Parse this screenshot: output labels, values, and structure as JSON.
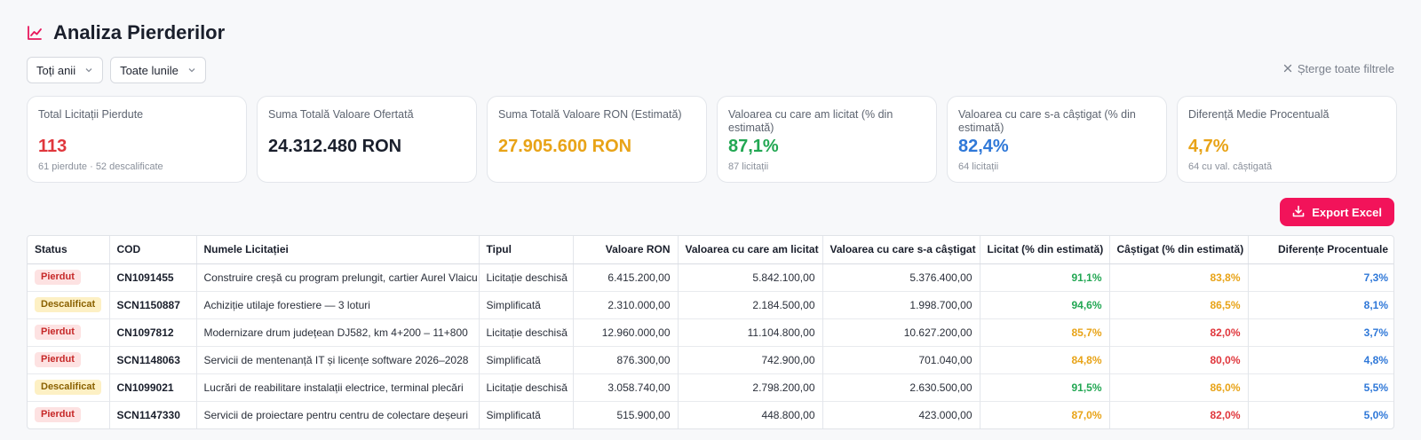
{
  "header": {
    "title": "Analiza Pierderilor",
    "icon": "line-chart-icon",
    "accent": "#e8175d"
  },
  "filters": {
    "year": "Toți anii",
    "month": "Toate lunile",
    "clear_label": "Șterge toate filtrele"
  },
  "cards": [
    {
      "label": "Total Licitații Pierdute",
      "value": "113",
      "sub": "61 pierdute · 52 descalificate",
      "color": "#e0363c"
    },
    {
      "label": "Suma Totală Valoare Ofertată",
      "value": "24.312.480 RON",
      "sub": "",
      "color": "#1a1f2c"
    },
    {
      "label": "Suma Totală Valoare RON (Estimată)",
      "value": "27.905.600 RON",
      "sub": "",
      "color": "#e8a317"
    },
    {
      "label": "Valoarea cu care am licitat (% din estimată)",
      "value": "87,1%",
      "sub": "87 licitații",
      "color": "#22a753"
    },
    {
      "label": "Valoarea cu care s-a câștigat (% din estimată)",
      "value": "82,4%",
      "sub": "64 licitații",
      "color": "#2f78d8"
    },
    {
      "label": "Diferență Medie Procentuală",
      "value": "4,7%",
      "sub": "64 cu val. câștigată",
      "color": "#e8a317"
    }
  ],
  "export": {
    "label": "Export Excel",
    "color": "#f2135a"
  },
  "table": {
    "headers": {
      "status": "Status",
      "cod": "COD",
      "name": "Numele Licitației",
      "type": "Tipul",
      "value_ron": "Valoare RON",
      "bid_value": "Valoarea cu care am licitat",
      "won_value": "Valoarea cu care s-a câștigat",
      "bid_pct": "Licitat (% din estimată)",
      "won_pct": "Câștigat (% din estimată)",
      "diff_pct": "Diferențe Procentuale"
    },
    "rows": [
      {
        "status": "Pierdut",
        "status_kind": "pierdut",
        "cod": "CN1091455",
        "name": "Construire creșă cu program prelungit, cartier Aurel Vlaicu",
        "type": "Licitație deschisă",
        "value_ron": "6.415.200,00",
        "bid_value": "5.842.100,00",
        "won_value": "5.376.400,00",
        "bid_pct": "91,1%",
        "bid_color": "green",
        "won_pct": "83,8%",
        "won_color": "orange",
        "diff_pct": "7,3%"
      },
      {
        "status": "Descalificat",
        "status_kind": "descalificat",
        "cod": "SCN1150887",
        "name": "Achiziție utilaje forestiere — 3 loturi",
        "type": "Simplificată",
        "value_ron": "2.310.000,00",
        "bid_value": "2.184.500,00",
        "won_value": "1.998.700,00",
        "bid_pct": "94,6%",
        "bid_color": "green",
        "won_pct": "86,5%",
        "won_color": "orange",
        "diff_pct": "8,1%"
      },
      {
        "status": "Pierdut",
        "status_kind": "pierdut",
        "cod": "CN1097812",
        "name": "Modernizare drum județean DJ582, km 4+200 – 11+800",
        "type": "Licitație deschisă",
        "value_ron": "12.960.000,00",
        "bid_value": "11.104.800,00",
        "won_value": "10.627.200,00",
        "bid_pct": "85,7%",
        "bid_color": "orange",
        "won_pct": "82,0%",
        "won_color": "red",
        "diff_pct": "3,7%"
      },
      {
        "status": "Pierdut",
        "status_kind": "pierdut",
        "cod": "SCN1148063",
        "name": "Servicii de mentenanță IT și licențe software 2026–2028",
        "type": "Simplificată",
        "value_ron": "876.300,00",
        "bid_value": "742.900,00",
        "won_value": "701.040,00",
        "bid_pct": "84,8%",
        "bid_color": "orange",
        "won_pct": "80,0%",
        "won_color": "red",
        "diff_pct": "4,8%"
      },
      {
        "status": "Descalificat",
        "status_kind": "descalificat",
        "cod": "CN1099021",
        "name": "Lucrări de reabilitare instalații electrice, terminal plecări",
        "type": "Licitație deschisă",
        "value_ron": "3.058.740,00",
        "bid_value": "2.798.200,00",
        "won_value": "2.630.500,00",
        "bid_pct": "91,5%",
        "bid_color": "green",
        "won_pct": "86,0%",
        "won_color": "orange",
        "diff_pct": "5,5%"
      },
      {
        "status": "Pierdut",
        "status_kind": "pierdut",
        "cod": "SCN1147330",
        "name": "Servicii de proiectare pentru centru de colectare deșeuri",
        "type": "Simplificată",
        "value_ron": "515.900,00",
        "bid_value": "448.800,00",
        "won_value": "423.000,00",
        "bid_pct": "87,0%",
        "bid_color": "orange",
        "won_pct": "82,0%",
        "won_color": "red",
        "diff_pct": "5,0%"
      }
    ]
  }
}
